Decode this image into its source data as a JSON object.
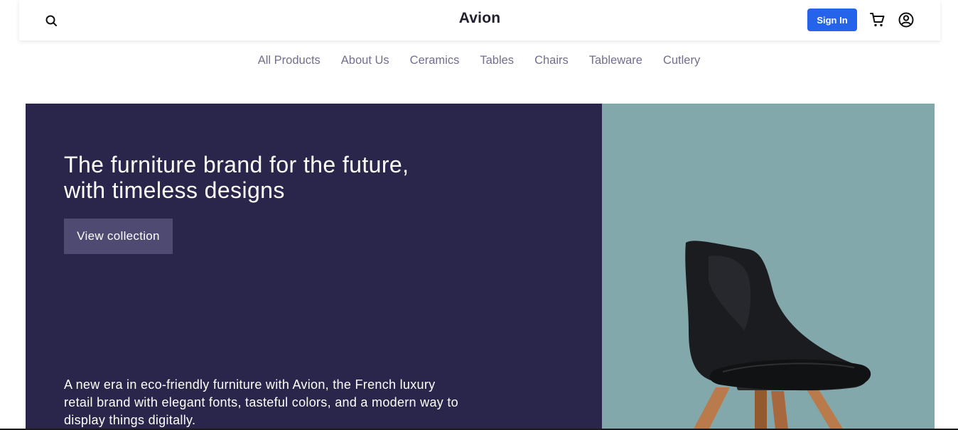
{
  "header": {
    "brand": "Avion",
    "sign_in_label": "Sign In",
    "icons": {
      "search": "search-icon",
      "cart": "cart-icon",
      "user": "user-circle-icon"
    },
    "accent_color": "#2563eb"
  },
  "nav": {
    "items": [
      "All Products",
      "About Us",
      "Ceramics",
      "Tables",
      "Chairs",
      "Tableware",
      "Cutlery"
    ]
  },
  "hero": {
    "title": "The furniture brand for the future, with timeless designs",
    "cta_label": "View collection",
    "description": "A new era in eco-friendly furniture with Avion, the French luxury retail brand with elegant fonts, tasteful colors, and a modern way to display things digitally.",
    "panel_color": "#2a254b",
    "image_background": "#83a8ab"
  }
}
